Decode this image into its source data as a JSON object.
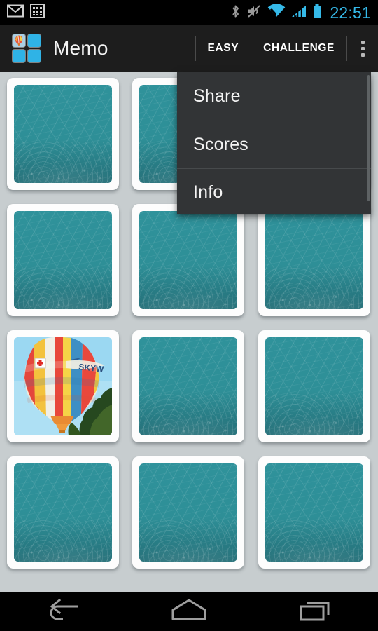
{
  "status_bar": {
    "icons_left": [
      "gmail-icon",
      "calculator-icon"
    ],
    "icons_right": [
      "bluetooth-icon",
      "volume-mute-icon",
      "wifi-icon",
      "cellular-signal-icon",
      "battery-icon"
    ],
    "time": "22:51",
    "accent_color": "#35b9e8",
    "background_color": "#000000"
  },
  "action_bar": {
    "app_icon": "memo-grid-icon",
    "title": "Memo",
    "tabs": [
      {
        "label": "EASY",
        "name": "tab-easy"
      },
      {
        "label": "CHALLENGE",
        "name": "tab-challenge"
      }
    ],
    "overflow_icon": "overflow-menu-icon",
    "background_color": "#1d1d1d"
  },
  "overflow_menu": {
    "open": true,
    "background_color": "#323436",
    "items": [
      {
        "label": "Share"
      },
      {
        "label": "Scores"
      },
      {
        "label": "Info"
      }
    ]
  },
  "board": {
    "background_color": "#c7cdcf",
    "columns": 3,
    "rows": 4,
    "card_back_color": "#2e8f97",
    "card_frame_color": "#fdfdfd",
    "cards": [
      {
        "id": 1,
        "row": 1,
        "col": 1,
        "state": "face-down",
        "face": "card-back"
      },
      {
        "id": 2,
        "row": 1,
        "col": 2,
        "state": "face-down",
        "face": "card-back"
      },
      {
        "id": 3,
        "row": 1,
        "col": 3,
        "state": "face-down",
        "face": "card-back"
      },
      {
        "id": 4,
        "row": 2,
        "col": 1,
        "state": "face-down",
        "face": "card-back"
      },
      {
        "id": 5,
        "row": 2,
        "col": 2,
        "state": "face-down",
        "face": "card-back"
      },
      {
        "id": 6,
        "row": 2,
        "col": 3,
        "state": "face-down",
        "face": "card-back"
      },
      {
        "id": 7,
        "row": 3,
        "col": 1,
        "state": "face-up",
        "face": "hot-air-balloon"
      },
      {
        "id": 8,
        "row": 3,
        "col": 2,
        "state": "face-down",
        "face": "card-back"
      },
      {
        "id": 9,
        "row": 3,
        "col": 3,
        "state": "face-down",
        "face": "card-back"
      },
      {
        "id": 10,
        "row": 4,
        "col": 1,
        "state": "face-down",
        "face": "card-back"
      },
      {
        "id": 11,
        "row": 4,
        "col": 2,
        "state": "face-down",
        "face": "card-back"
      },
      {
        "id": 12,
        "row": 4,
        "col": 3,
        "state": "face-down",
        "face": "card-back"
      }
    ],
    "revealed_card_label": "SKYW"
  },
  "nav_bar": {
    "background_color": "#000000",
    "buttons": [
      {
        "name": "nav-back-button",
        "icon": "back-arrow-icon"
      },
      {
        "name": "nav-home-button",
        "icon": "home-icon"
      },
      {
        "name": "nav-recents-button",
        "icon": "recents-icon"
      }
    ]
  }
}
